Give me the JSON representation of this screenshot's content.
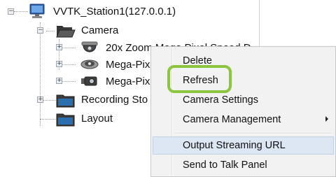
{
  "tree": {
    "station": {
      "label": "VVTK_Station1(127.0.0.1)",
      "icon": "computer-icon",
      "expander": "−"
    },
    "camera": {
      "label": "Camera",
      "icon": "folder-open-icon",
      "expander": "−"
    },
    "devices": [
      {
        "label": "20x Zoom Mega Pixel Speed D",
        "icon": "dome-camera-icon",
        "expander": "+"
      },
      {
        "label": "Mega-Pix",
        "icon": "fisheye-camera-icon",
        "expander": "+"
      },
      {
        "label": "Mega-Pix",
        "icon": "bullet-camera-icon",
        "expander": "+"
      }
    ],
    "recording": {
      "label": "Recording Sto",
      "icon": "folder-icon",
      "expander": "+"
    },
    "layout": {
      "label": "Layout",
      "icon": "folder-icon"
    }
  },
  "context_menu": {
    "items": [
      {
        "label": "Delete"
      },
      {
        "label": "Refresh"
      },
      {
        "label": "Camera Settings"
      },
      {
        "label": "Camera Management",
        "has_submenu": true
      },
      {
        "label": "Output Streaming URL",
        "hovered": true
      },
      {
        "label": "Send to Talk Panel"
      }
    ]
  },
  "colors": {
    "highlight": "#8cc63f",
    "menu_background": "#f2f2f2",
    "hover_background": "#dde6f3"
  }
}
